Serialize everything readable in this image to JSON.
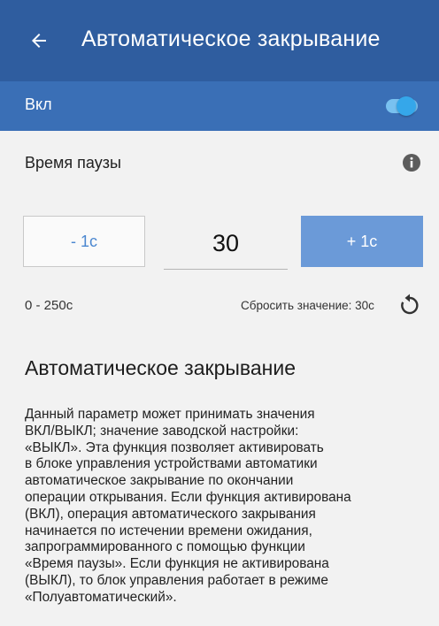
{
  "appbar": {
    "back_icon": "arrow-left-icon",
    "title": "Автоматическое закрывание"
  },
  "toggle": {
    "label": "Вкл",
    "state": "on",
    "accent": "#35a7ea"
  },
  "pause": {
    "label": "Время паузы",
    "info_icon": "info-icon",
    "decrement_label": "- 1с",
    "value": "30",
    "increment_label": "+ 1с",
    "range": "0 - 250с",
    "reset_label": "Сбросить значение: 30с",
    "reset_icon": "reset-icon"
  },
  "description": {
    "title": "Автоматическое закрывание",
    "lines": [
      "Данный параметр может принимать значения",
      "ВКЛ/ВЫКЛ; значение заводской настройки:",
      "«ВЫКЛ». Эта функция позволяет активировать",
      "в блоке управления устройствами автоматики",
      "автоматическое закрывание по окончании",
      "операции открывания. Если функция активирована",
      "(ВКЛ), операция автоматического закрывания",
      "начинается по истечении времени ожидания,",
      "запрограммированного с помощью функции",
      "«Время паузы». Если функция не активирована",
      "(ВЫКЛ), то блок управления работает в режиме",
      "«Полуавтоматический»."
    ]
  },
  "colors": {
    "appbar": "#2f5d9f",
    "toggle_row": "#3a6fb6",
    "primary_button": "#6b9ad8",
    "background": "#f2f2f2"
  }
}
